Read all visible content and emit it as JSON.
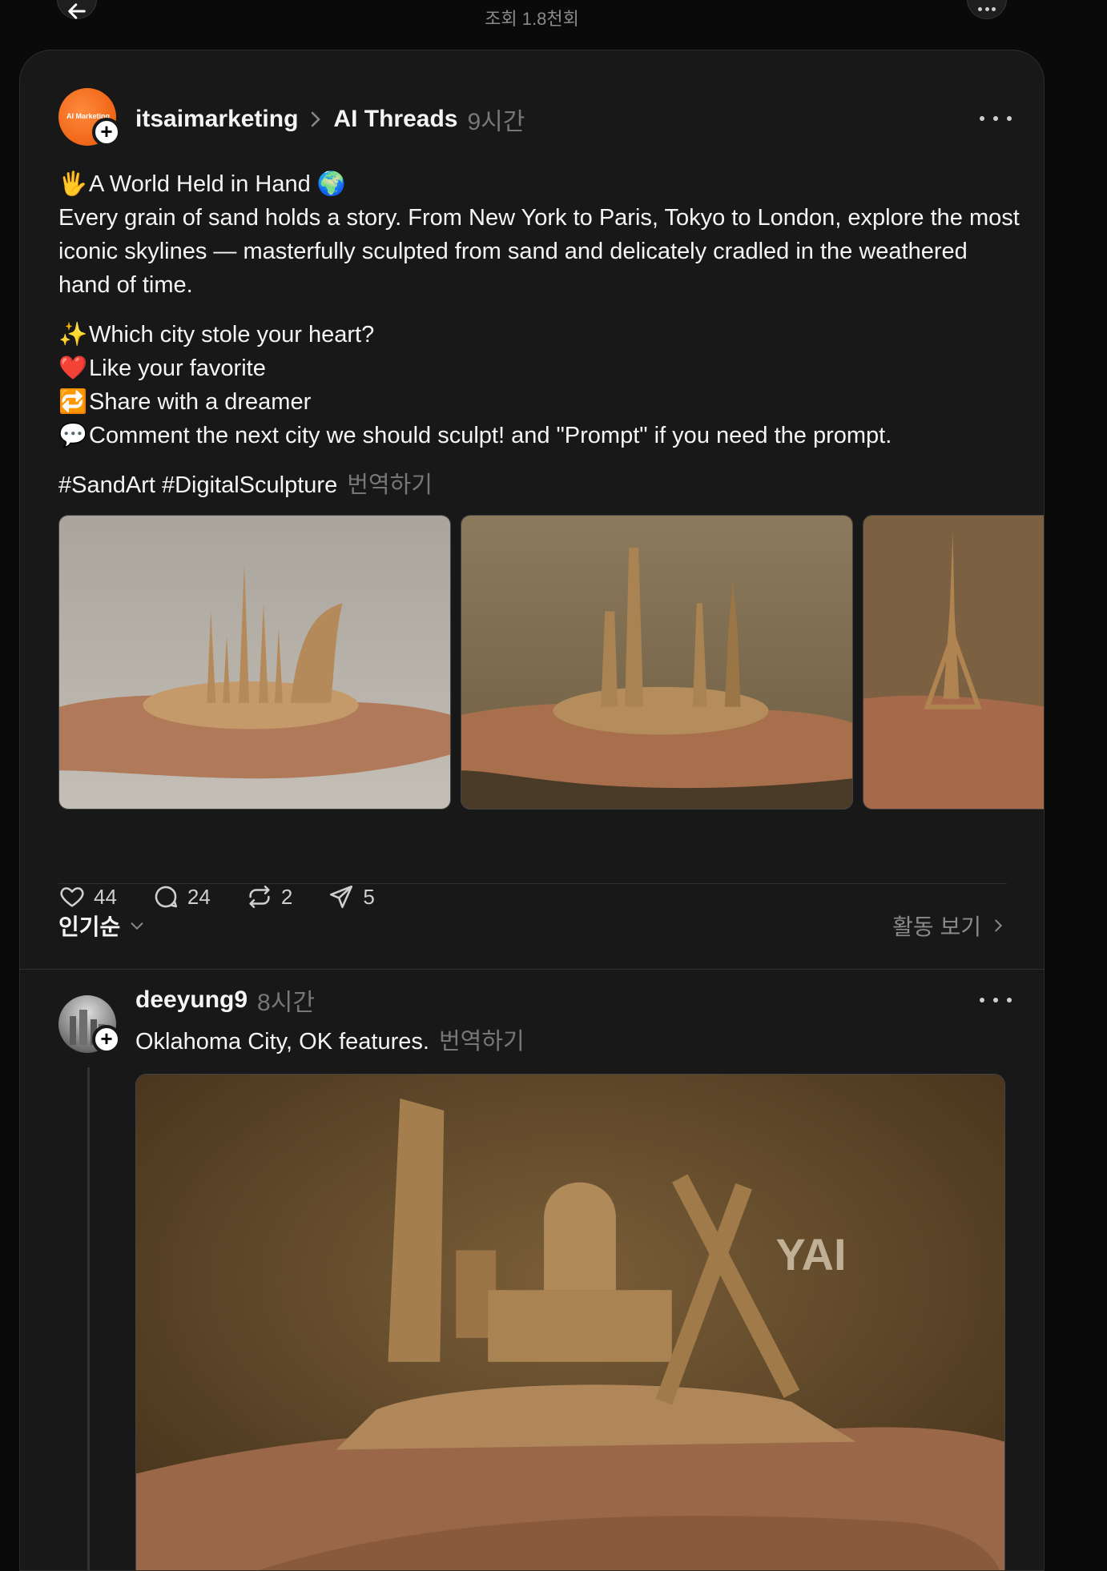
{
  "top_bar": {
    "views": "조회 1.8천회"
  },
  "post": {
    "username": "itsaimarketing",
    "avatar_text": "AI Marketing",
    "community": "AI Threads",
    "time": "9시간",
    "title_emoji": "🖐",
    "title": "A World Held in Hand",
    "title_end_emoji": "🌍",
    "body": "Every grain of sand holds a story. From New York to Paris, Tokyo to London, explore the most iconic skylines — masterfully sculpted from sand and delicately cradled in the weathered hand of time.",
    "cta": [
      {
        "emoji": "✨",
        "text": "Which city stole your heart?"
      },
      {
        "emoji": "❤️",
        "text": "Like your favorite"
      },
      {
        "emoji": "🔁",
        "text": "Share with a dreamer"
      },
      {
        "emoji": "💬",
        "text": "Comment the next city we should sculpt! and \"Prompt\" if you need the prompt."
      }
    ],
    "hashtags": "#SandArt #DigitalSculpture",
    "translate": "번역하기",
    "likes": "44",
    "comments": "24",
    "reposts": "2",
    "shares": "5"
  },
  "sort": {
    "label": "인기순",
    "activity": "활동 보기"
  },
  "reply": {
    "username": "deeyung9",
    "time": "8시간",
    "text": "Oklahoma City, OK features.",
    "translate": "번역하기",
    "watermark": "YAI"
  }
}
